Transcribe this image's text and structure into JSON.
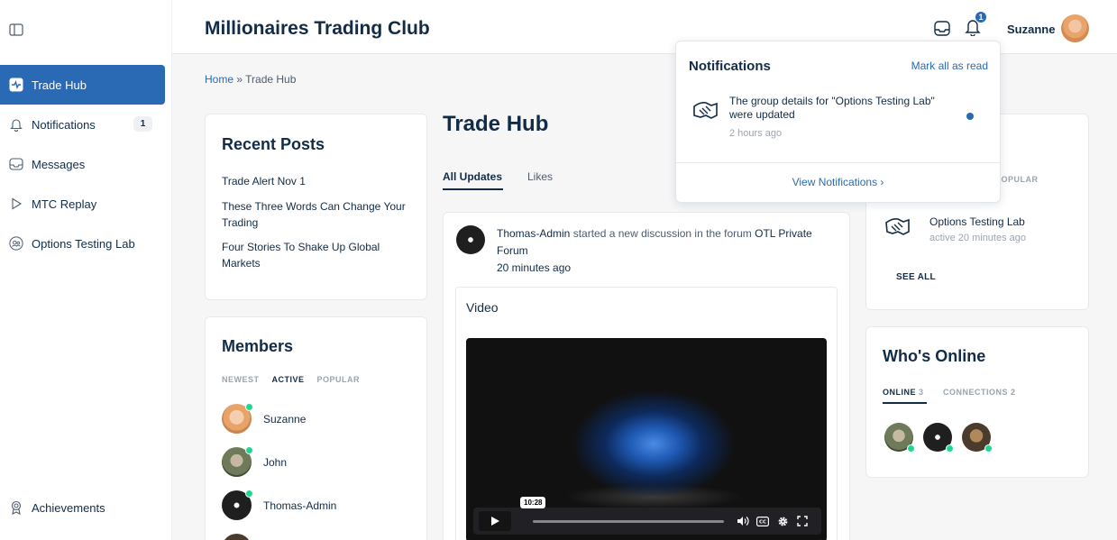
{
  "sidebar": {
    "items": [
      {
        "label": "Trade Hub",
        "icon": "activity-icon"
      },
      {
        "label": "Notifications",
        "icon": "bell-icon",
        "count": "1"
      },
      {
        "label": "Messages",
        "icon": "inbox-icon"
      },
      {
        "label": "MTC Replay",
        "icon": "play-icon"
      },
      {
        "label": "Options Testing Lab",
        "icon": "group-icon"
      }
    ],
    "bottom_item": {
      "label": "Achievements",
      "icon": "award-icon"
    }
  },
  "header": {
    "title": "Millionaires Trading Club",
    "bell_badge": "1",
    "user_name": "Suzanne"
  },
  "breadcrumb": {
    "home": "Home",
    "separator": " » ",
    "current": "Trade Hub"
  },
  "recent_posts": {
    "title": "Recent Posts",
    "items": [
      "Trade Alert Nov 1",
      "These Three Words Can Change Your Trading",
      "Four Stories To Shake Up Global Markets"
    ]
  },
  "members": {
    "title": "Members",
    "tabs": [
      "NEWEST",
      "ACTIVE",
      "POPULAR"
    ],
    "active_tab": "ACTIVE",
    "list": [
      "Suzanne",
      "John",
      "Thomas-Admin"
    ]
  },
  "main": {
    "title": "Trade Hub",
    "tabs": [
      "All Updates",
      "Likes"
    ],
    "feed": {
      "author": "Thomas-Admin",
      "action": " started a new discussion in the forum ",
      "forum": "OTL Private Forum",
      "time": "20 minutes ago",
      "video_label": "Video",
      "video_time": "10:28"
    }
  },
  "groups": {
    "tab_popular": "POPULAR",
    "group_name": "Options Testing Lab",
    "group_active": "active 20 minutes ago",
    "see_all": "SEE ALL"
  },
  "whos_online": {
    "title": "Who's Online",
    "tab_online": "ONLINE",
    "online_count": "3",
    "tab_connections": "CONNECTIONS",
    "connections_count": "2"
  },
  "notifications_popup": {
    "title": "Notifications",
    "mark_all": "Mark all as read",
    "item_text": "The group details for \"Options Testing Lab\" were updated",
    "item_time": "2 hours ago",
    "view_link": "View Notifications ›"
  },
  "colors": {
    "accent": "#2a69b3",
    "text": "#122b46",
    "online": "#1cd991"
  }
}
